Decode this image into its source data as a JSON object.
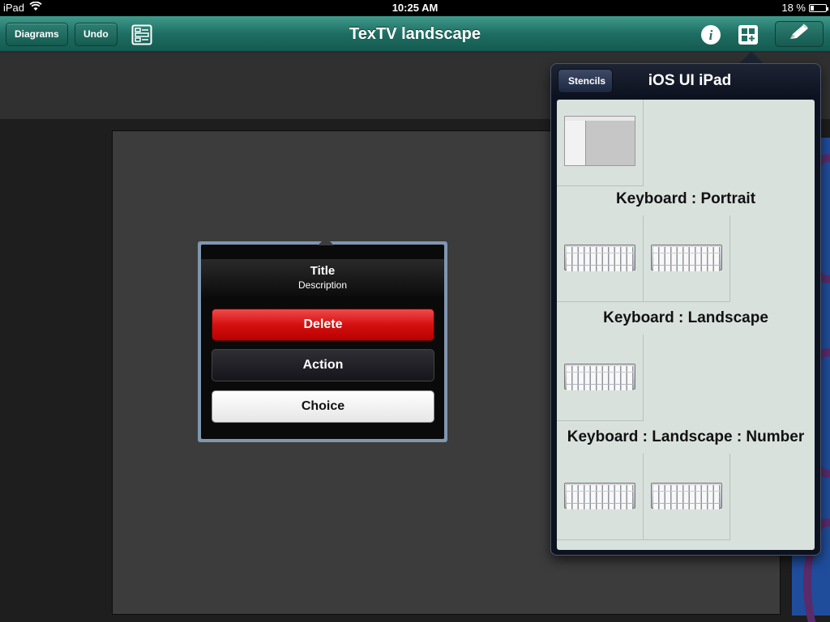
{
  "status_bar": {
    "device": "iPad",
    "time": "10:25 AM",
    "battery_percent": "18 %",
    "battery_level": 0.18
  },
  "nav": {
    "diagrams_label": "Diagrams",
    "undo_label": "Undo",
    "title": "TexTV landscape",
    "info_icon": "info-icon",
    "stencils_icon": "stencils-grid-icon",
    "pencil_icon": "pencil-icon",
    "outline_icon": "outline-list-icon",
    "accent_color": "#1f6e63"
  },
  "action_sheet": {
    "title": "Title",
    "description": "Description",
    "buttons": [
      {
        "label": "Delete",
        "style": "destructive",
        "color": "#d41010"
      },
      {
        "label": "Action",
        "style": "dark"
      },
      {
        "label": "Choice",
        "style": "light"
      }
    ]
  },
  "stencil_popover": {
    "back_label": "Stencils",
    "title": "iOS UI iPad",
    "sections": [
      {
        "title": "",
        "items": [
          "ipad-layout-thumbnail"
        ]
      },
      {
        "title": "Keyboard : Portrait",
        "items": [
          "keyboard-thumbnail",
          "keyboard-thumbnail"
        ]
      },
      {
        "title": "Keyboard : Landscape",
        "items": [
          "keyboard-thumbnail"
        ]
      },
      {
        "title": "Keyboard : Landscape : Number",
        "items": [
          "keyboard-thumbnail",
          "keyboard-thumbnail"
        ]
      }
    ]
  }
}
